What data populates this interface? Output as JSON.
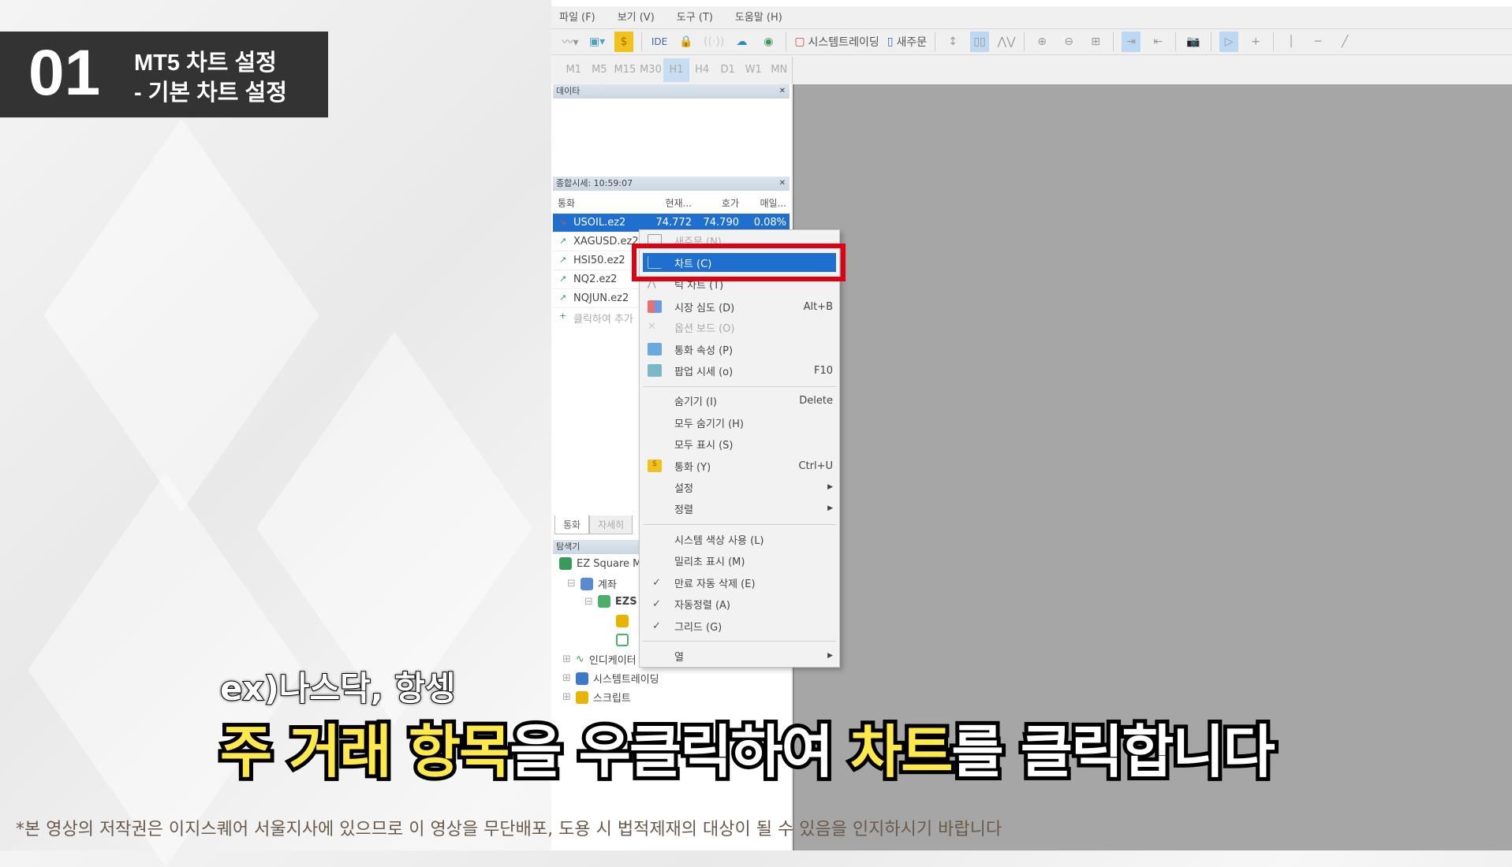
{
  "card": {
    "number": "01",
    "title": "MT5 차트 설정",
    "subtitle": "- 기본 차트 설정"
  },
  "menubar": [
    "파일 (F)",
    "보기 (V)",
    "도구 (T)",
    "도움말 (H)"
  ],
  "toolbar": {
    "ide": "IDE",
    "system_trading": "시스템트레이딩",
    "new_order": "새주문"
  },
  "timeframes": [
    "M1",
    "M5",
    "M15",
    "M30",
    "H1",
    "H4",
    "D1",
    "W1",
    "MN"
  ],
  "timeframe_selected": "H1",
  "data_panel": {
    "title": "데이타"
  },
  "market_watch": {
    "title": "종합시세: 10:59:07",
    "columns": [
      "통화",
      "현재...",
      "호가",
      "매일..."
    ],
    "rows": [
      {
        "symbol": "USOIL.ez2",
        "bid": "74.772",
        "ask": "74.790",
        "change": "0.08%"
      },
      {
        "symbol": "XAGUSD.ez2"
      },
      {
        "symbol": "HSI50.ez2"
      },
      {
        "symbol": "NQ2.ez2"
      },
      {
        "symbol": "NQJUN.ez2"
      }
    ],
    "add_label": "클릭하여 추가",
    "tabs": [
      "통화",
      "자세히"
    ]
  },
  "navigator": {
    "title": "탐색기",
    "items": [
      "EZ Square MT5",
      "계좌",
      "EZS",
      "",
      "",
      "인디케이터",
      "시스템트레이딩",
      "스크립트"
    ]
  },
  "context_menu": {
    "items": [
      {
        "label": "새주문 (N)",
        "icon": "new-order"
      },
      {
        "label": "차트 (C)",
        "icon": "chart",
        "highlighted": true
      },
      {
        "label": "틱 차트 (T)",
        "icon": "tick-chart"
      },
      {
        "label": "시장 심도 (D)",
        "shortcut": "Alt+B",
        "icon": "depth"
      },
      {
        "label": "옵션 보드 (O)",
        "icon": "option",
        "disabled": true
      },
      {
        "label": "통화 속성 (P)",
        "icon": "properties"
      },
      {
        "label": "팝업 시세 (o)",
        "shortcut": "F10",
        "icon": "popup"
      },
      {
        "label": "숨기기 (I)",
        "shortcut": "Delete"
      },
      {
        "label": "모두 숨기기 (H)"
      },
      {
        "label": "모두 표시 (S)"
      },
      {
        "label": "통화 (Y)",
        "shortcut": "Ctrl+U",
        "icon": "symbols"
      },
      {
        "label": "설정",
        "submenu": true
      },
      {
        "label": "정렬",
        "submenu": true
      },
      {
        "label": "시스템 색상 사용 (L)"
      },
      {
        "label": "밀리초 표시 (M)"
      },
      {
        "label": "만료 자동 삭제 (E)",
        "checked": true
      },
      {
        "label": "자동정렬 (A)",
        "checked": true
      },
      {
        "label": "그리드 (G)",
        "checked": true
      },
      {
        "label": "열",
        "submenu": true
      }
    ]
  },
  "subtitle": {
    "small": "ex)나스닥, 항셍",
    "parts": [
      "주 거래 항목",
      "을 우클릭하여 ",
      "차트",
      "를 클릭합니다"
    ]
  },
  "footer": "*본 영상의 저작권은 이지스퀘어 서울지사에 있으므로 이 영상을 무단배포, 도용 시 법적제재의 대상이 될 수 있음을 인지하시기 바랍니다",
  "colors": {
    "highlight": "#1f6fce",
    "red_box": "#e00010",
    "subtitle_accent": "#ffe94a"
  }
}
